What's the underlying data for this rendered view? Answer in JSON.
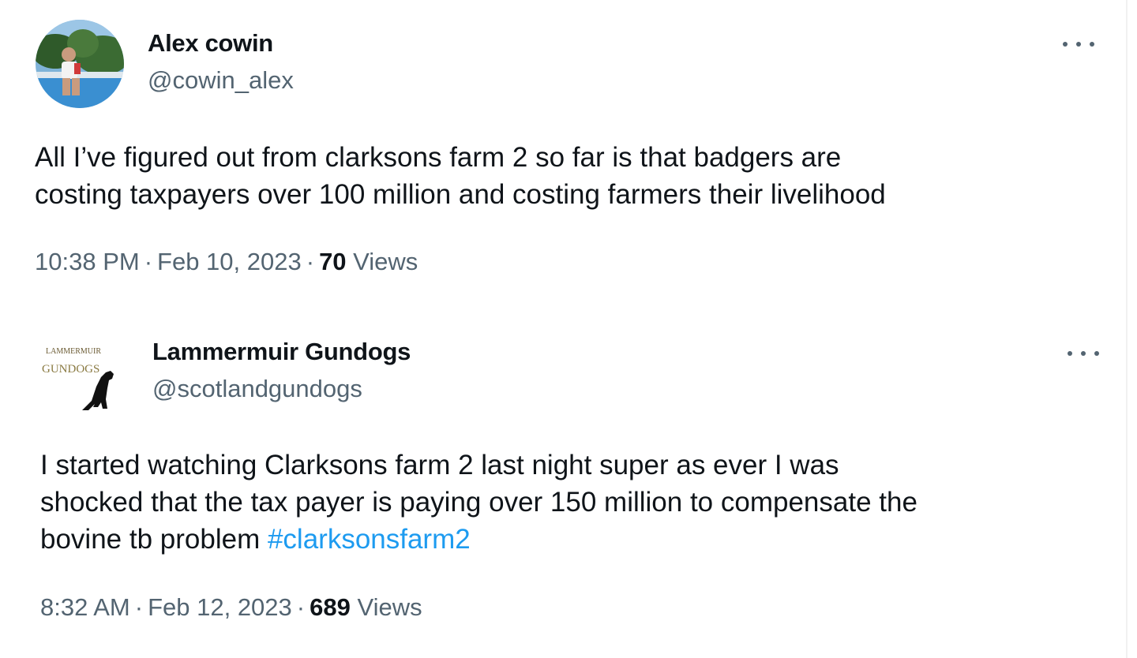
{
  "tweets": [
    {
      "author_name": "Alex cowin",
      "handle": "@cowin_alex",
      "text": "All I’ve figured out from clarksons farm 2 so far is that badgers are\ncosting taxpayers over 100 million and costing farmers their livelihood",
      "hashtag": "",
      "time": "10:38 PM",
      "date": "Feb 10, 2023",
      "views_count": "70",
      "views_label": "Views",
      "avatar_icon": "profile-photo",
      "more_icon": "more-options-icon"
    },
    {
      "author_name": "Lammermuir Gundogs",
      "handle": "@scotlandgundogs",
      "text": "I started watching Clarksons farm 2 last night super as ever I was\nshocked that the tax payer is paying over 150 million to compensate the\nbovine tb problem ",
      "hashtag": "#clarksonsfarm2",
      "time": "8:32 AM",
      "date": "Feb 12, 2023",
      "views_count": "689",
      "views_label": "Views",
      "avatar_icon": "lammermuir-gundogs-logo",
      "logo_text_top": "LAMMERMUIR",
      "logo_text_bottom": "GUNDOGS",
      "more_icon": "more-options-icon"
    }
  ],
  "colors": {
    "text": "#0f1419",
    "secondary": "#536471",
    "link": "#1d9bf0",
    "background": "#ffffff"
  }
}
